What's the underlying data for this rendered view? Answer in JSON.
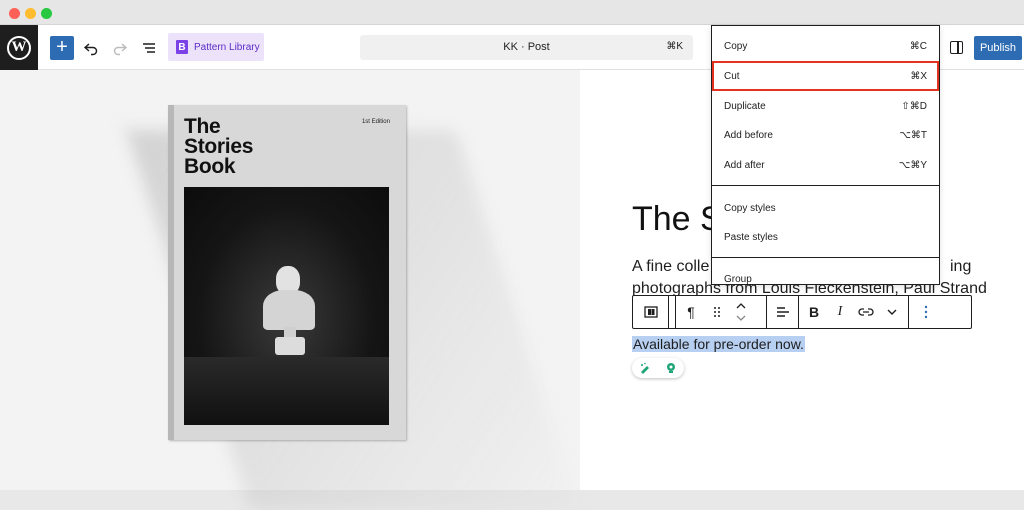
{
  "window": {
    "controls": [
      "close",
      "minimize",
      "zoom"
    ]
  },
  "header": {
    "logo": "W",
    "add_block": "+",
    "pattern_library": "Pattern Library",
    "pattern_icon": "B",
    "document_title": "KK · Post",
    "command_shortcut": "⌘K",
    "publish": "Publish"
  },
  "book": {
    "title": "The Stories Book",
    "edition": "1st Edition"
  },
  "content": {
    "heading": "The S",
    "para_line1": "A fine colle",
    "para_line1_end": "ing",
    "para_line2": "photographs from Louis Fleckenstein, Paul Strand",
    "para_line3": "A",
    "preorder": "Available for pre-order now."
  },
  "context_menu": {
    "items": [
      {
        "label": "Copy",
        "shortcut": "⌘C"
      },
      {
        "label": "Cut",
        "shortcut": "⌘X"
      },
      {
        "label": "Duplicate",
        "shortcut": "⇧⌘D"
      },
      {
        "label": "Add before",
        "shortcut": "⌥⌘T"
      },
      {
        "label": "Add after",
        "shortcut": "⌥⌘Y"
      },
      {
        "label": "Copy styles",
        "shortcut": ""
      },
      {
        "label": "Paste styles",
        "shortcut": ""
      },
      {
        "label": "Group",
        "shortcut": ""
      }
    ],
    "highlighted": "Cut"
  },
  "block_toolbar": {
    "paragraph": "¶",
    "bold": "B",
    "italic": "I"
  },
  "colors": {
    "accent": "#2d6cb3",
    "highlight_border": "#e5321f",
    "selection": "#b7cff0",
    "pattern_purple": "#7b42e8"
  }
}
